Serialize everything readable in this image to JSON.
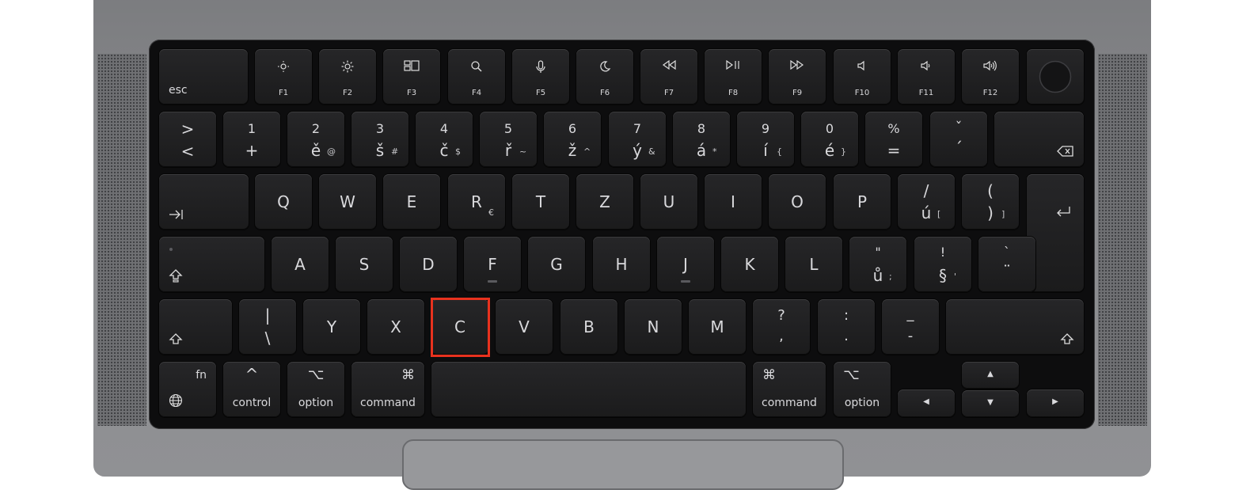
{
  "fn_row": {
    "esc": "esc",
    "f_keys": [
      {
        "label": "F1",
        "icon": "brightness-down-icon"
      },
      {
        "label": "F2",
        "icon": "brightness-up-icon"
      },
      {
        "label": "F3",
        "icon": "mission-control-icon"
      },
      {
        "label": "F4",
        "icon": "search-icon"
      },
      {
        "label": "F5",
        "icon": "microphone-icon"
      },
      {
        "label": "F6",
        "icon": "moon-icon"
      },
      {
        "label": "F7",
        "icon": "rewind-icon"
      },
      {
        "label": "F8",
        "icon": "play-pause-icon"
      },
      {
        "label": "F9",
        "icon": "fast-forward-icon"
      },
      {
        "label": "F10",
        "icon": "mute-icon"
      },
      {
        "label": "F11",
        "icon": "volume-down-icon"
      },
      {
        "label": "F12",
        "icon": "volume-up-icon"
      }
    ],
    "touch_id_icon": "touch-id-icon"
  },
  "number_row": {
    "first": {
      "top": ">",
      "bottom": "<"
    },
    "keys": [
      {
        "top": "1",
        "bottom": "+",
        "alt": ""
      },
      {
        "top": "2",
        "bottom": "ě",
        "alt": "@"
      },
      {
        "top": "3",
        "bottom": "š",
        "alt": "#"
      },
      {
        "top": "4",
        "bottom": "č",
        "alt": "$"
      },
      {
        "top": "5",
        "bottom": "ř",
        "alt": "~"
      },
      {
        "top": "6",
        "bottom": "ž",
        "alt": "^"
      },
      {
        "top": "7",
        "bottom": "ý",
        "alt": "&"
      },
      {
        "top": "8",
        "bottom": "á",
        "alt": "*"
      },
      {
        "top": "9",
        "bottom": "í",
        "alt": "{"
      },
      {
        "top": "0",
        "bottom": "é",
        "alt": "}"
      },
      {
        "top": "%",
        "bottom": "=",
        "alt": ""
      },
      {
        "top": "ˇ",
        "bottom": "´",
        "alt": ""
      }
    ],
    "delete_icon": "delete-icon"
  },
  "row_q": {
    "tab_icon": "tab-icon",
    "letters": [
      "Q",
      "W",
      "E",
      "R",
      "T",
      "Z",
      "U",
      "I",
      "O",
      "P"
    ],
    "r_alt": "€",
    "k1": {
      "top": "/",
      "bottom": "ú",
      "alt": "["
    },
    "k2": {
      "top": "(",
      "bottom": ")",
      "alt": "]"
    },
    "return_icon": "return-icon"
  },
  "row_a": {
    "caps_icon": "caps-lock-icon",
    "letters": [
      "A",
      "S",
      "D",
      "F",
      "G",
      "H",
      "J",
      "K",
      "L"
    ],
    "k1": {
      "top": "\"",
      "bottom": "ů",
      "alt": ";"
    },
    "k2": {
      "top": "!",
      "bottom": "§",
      "alt": "'"
    },
    "k3": {
      "top": "`",
      "bottom": "¨"
    }
  },
  "row_z": {
    "shift_icon": "shift-icon",
    "pipe": {
      "top": "|",
      "bottom": "\\"
    },
    "letters": [
      "Y",
      "X",
      "C",
      "V",
      "B",
      "N",
      "M"
    ],
    "k1": {
      "top": "?",
      "bottom": ","
    },
    "k2": {
      "top": ":",
      "bottom": "."
    },
    "k3": {
      "top": "_",
      "bottom": "-"
    }
  },
  "bottom_row": {
    "fn": "fn",
    "globe_icon": "globe-icon",
    "control": "control",
    "control_symbol": "^",
    "option": "option",
    "option_symbol": "⌥",
    "command": "command",
    "command_symbol": "⌘",
    "arrows": {
      "up": "▲",
      "down": "▼",
      "left": "◀",
      "right": "▶"
    }
  },
  "highlight": {
    "key": "C",
    "color": "#e8321e"
  }
}
